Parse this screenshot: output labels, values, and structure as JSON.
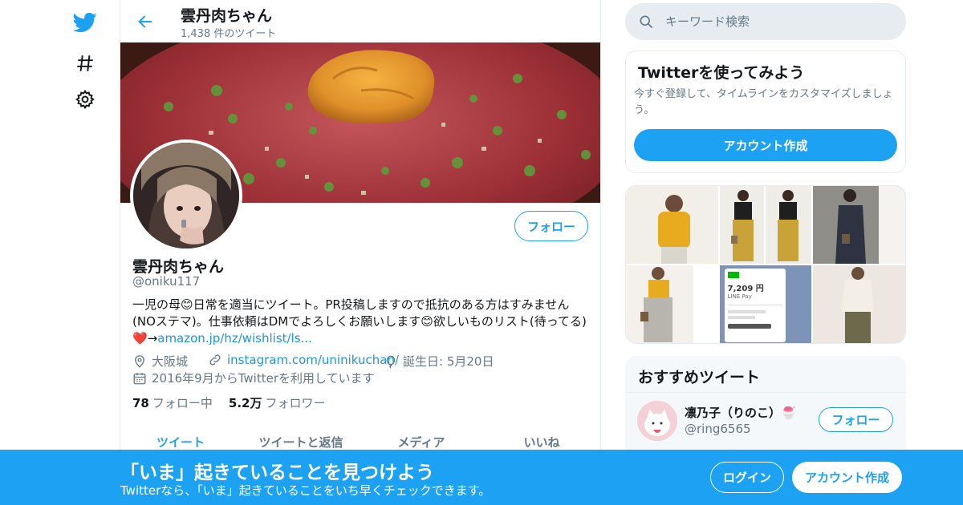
{
  "colors": {
    "accent": "#1da1f2",
    "link": "#1b95e0",
    "muted": "#657786",
    "text": "#14171a",
    "border": "#e6ecf0"
  },
  "nav": {
    "icons": [
      "twitter-logo-icon",
      "hashtag-icon",
      "gear-icon"
    ]
  },
  "header": {
    "name": "雲丹肉ちゃん",
    "tweet_count": "1,438 件のツイート"
  },
  "profile": {
    "follow_label": "フォロー",
    "name": "雲丹肉ちゃん",
    "handle": "@oniku117",
    "bio_line1": "一児の母😊日常を適当にツイート。PR投稿しますので抵抗のある方はすみません",
    "bio_line2": "(NOステマ)。仕事依頼はDMでよろしくお願いします😊欲しいものリスト(待ってる)",
    "bio_line3_prefix": "❤️→",
    "bio_link": "amazon.jp/hz/wishlist/ls...",
    "location": "大阪城",
    "website": "instagram.com/uninikuchan/",
    "birthday": "誕生日: 5月20日",
    "joined": "2016年9月からTwitterを利用しています",
    "following_count": "78",
    "following_label": "フォロー中",
    "followers_count": "5.2万",
    "followers_label": "フォロワー"
  },
  "tabs": [
    "ツイート",
    "ツイートと返信",
    "メディア",
    "いいね"
  ],
  "search": {
    "placeholder": "キーワード検索"
  },
  "try_twitter": {
    "title": "Twitterを使ってみよう",
    "description": "今すぐ登録して、タイムラインをカスタマイズしましょう。",
    "button": "アカウント作成"
  },
  "recommended": {
    "title": "おすすめツイート",
    "name": "凛乃子（りのこ）🍧",
    "handle": "@ring6565",
    "follow_label": "フォロー"
  },
  "bottom_bar": {
    "title": "「いま」起きていることを見つけよう",
    "subtitle": "Twitterなら、「いま」起きていることをいち早くチェックできます。",
    "login": "ログイン",
    "signup": "アカウント作成"
  },
  "media_image": {
    "price": "7,209 円",
    "pay_label": "LINE Pay"
  }
}
